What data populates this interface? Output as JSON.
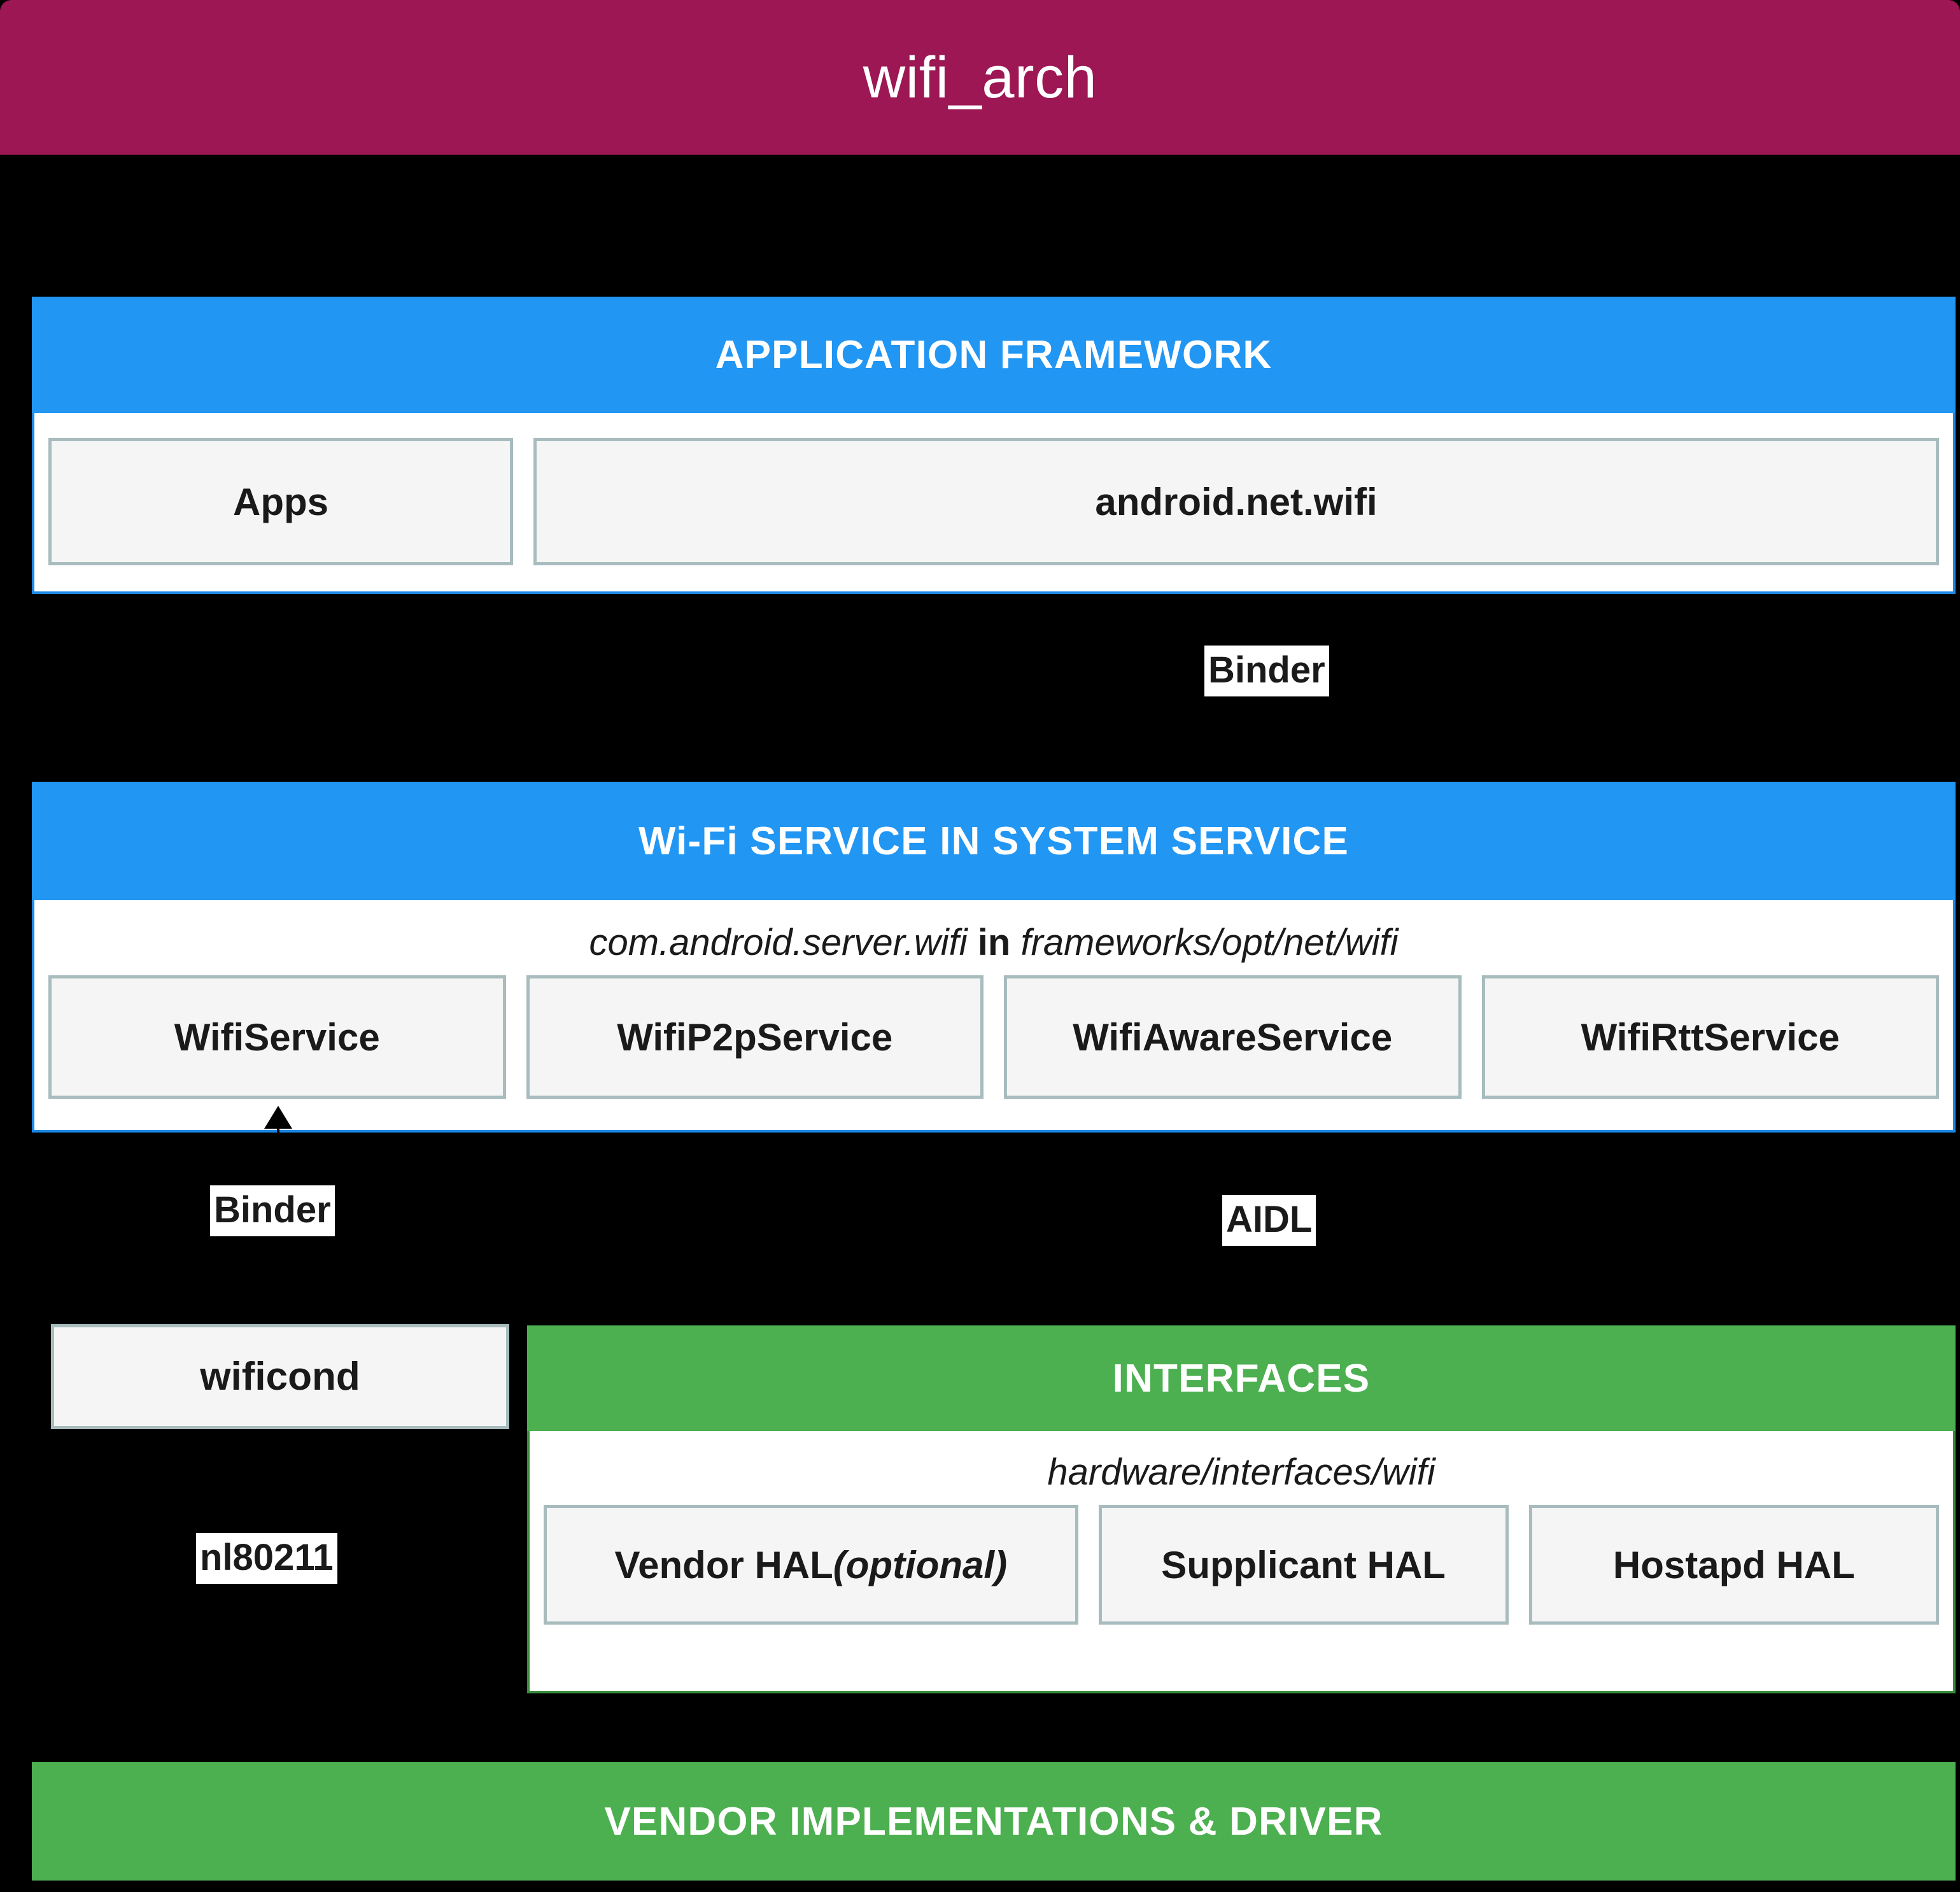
{
  "diagram": {
    "title": "wifi_arch",
    "colors": {
      "title_bar": "#9C1754",
      "framework_band": "#2196F3",
      "vendor_band": "#4CAF50",
      "node_fill": "#F5F5F5",
      "node_border": "#A8BCBE",
      "background": "#000000"
    }
  },
  "application_framework": {
    "header": "APPLICATION FRAMEWORK",
    "nodes": [
      {
        "label": "Apps"
      },
      {
        "label": "android.net.wifi"
      }
    ]
  },
  "connector_framework_to_service": {
    "label": "Binder"
  },
  "wifi_service": {
    "header": "Wi-Fi SERVICE IN SYSTEM SERVICE",
    "path_prefix": "com.android.server.wifi",
    "path_joiner": "in",
    "path_suffix": "frameworks/opt/net/wifi",
    "nodes": [
      {
        "label": "WifiService"
      },
      {
        "label": "WifiP2pService"
      },
      {
        "label": "WifiAwareService"
      },
      {
        "label": "WifiRttService"
      }
    ]
  },
  "connector_service_to_wificond": {
    "label": "Binder"
  },
  "connector_service_to_interfaces": {
    "label": "AIDL"
  },
  "wificond": {
    "label": "wificond"
  },
  "connector_wificond_to_vendor": {
    "label": "nl80211"
  },
  "interfaces": {
    "header": "INTERFACES",
    "path": "hardware/interfaces/wifi",
    "nodes": [
      {
        "label": "Vendor HAL ",
        "emphasis": "(optional)"
      },
      {
        "label": "Supplicant HAL",
        "emphasis": ""
      },
      {
        "label": "Hostapd HAL",
        "emphasis": ""
      }
    ]
  },
  "vendor_implementations": {
    "header": "VENDOR IMPLEMENTATIONS & DRIVER"
  }
}
